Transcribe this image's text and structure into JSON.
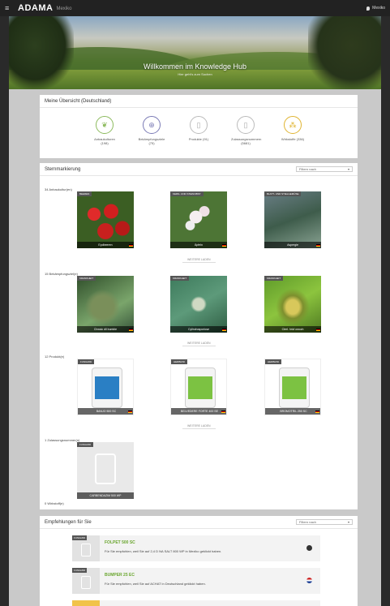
{
  "topbar": {
    "menu_icon": "≡",
    "logo": "ADAMA",
    "logo_sub": "Mexiko",
    "user_label": "Mexiko"
  },
  "hero": {
    "title": "Willkommen im Knowledge Hub",
    "subtitle": "Hier geht's zum Suchen"
  },
  "overview": {
    "title": "Meine Übersicht (Deutschland)",
    "items": [
      {
        "label": "Anbaukulturen (198)",
        "icon": "sprout-icon",
        "glyph": "❦",
        "color": "#8dbb5e"
      },
      {
        "label": "Bekämpfungsziele (75)",
        "icon": "target-icon",
        "glyph": "⊕",
        "color": "#7a7ab5"
      },
      {
        "label": "Produkte (91)",
        "icon": "canister-icon",
        "glyph": "▯",
        "color": "#aaaaaa"
      },
      {
        "label": "Zulassungsnummern (5681)",
        "icon": "document-icon",
        "glyph": "▯",
        "color": "#aaaaaa"
      },
      {
        "label": "Wirkstoffe (336)",
        "icon": "molecule-icon",
        "glyph": "⁂",
        "color": "#e0b430"
      }
    ]
  },
  "stars": {
    "title": "Sternmarkierung",
    "filter": "Filtern nach",
    "crops_label": "34 Anbaukultur(en)",
    "crops": [
      {
        "tag": "BEEREN",
        "name": "Ерdbeeren"
      },
      {
        "tag": "KERN- UND STEINOBST",
        "name": "Äpfeln"
      },
      {
        "tag": "BLATT- UND STIELGEMÜSE",
        "name": "Aspergie"
      }
    ],
    "more1": "WEITERE LADEN",
    "targets_label": "15 Bekämpfungsziel(e)",
    "targets": [
      {
        "tag": "KRANKHEIT",
        "name": "Chwsiс dll bumble"
      },
      {
        "tag": "KRANKHEIT",
        "name": "Cylindrosporiose"
      },
      {
        "tag": "KRANKHEIT",
        "name": "Cterl. hrivl owoch"
      }
    ],
    "more2": "WEITERE LADEN",
    "products_label": "12 Produkt(e)",
    "products": [
      {
        "tag": "FUNGIZID",
        "name": "BANJO 500 SC",
        "label_color": "#2a7fc4"
      },
      {
        "tag": "HERBIZID",
        "name": "BELVEDERE FORTE 400 SE",
        "label_color": "#7cc242"
      },
      {
        "tag": "HERBIZID",
        "name": "BROMOTRIL 250 SC",
        "label_color": "#7cc242"
      }
    ],
    "more3": "WEITERE LADEN",
    "regs_label": "1 Zulassungsnummer(n)",
    "regs": [
      {
        "tag": "FUNGIZID",
        "name": "CARBENDAZIM 500 WP"
      }
    ],
    "actives_label": "0 Wirkstoff(e)"
  },
  "recs": {
    "title": "Empfehlungen für Sie",
    "filter": "Filtern nach",
    "items": [
      {
        "tag": "FUNGIZID",
        "name": "FOLPET 500 SC",
        "desc": "Für Sie empfohlen, weil Sie auf 2,4 D NA SALT 800 WP in Mexiko geklickt haben."
      },
      {
        "tag": "FUNGIZID",
        "name": "BUMPER 25 EC",
        "desc": "Für Sie empfohlen, weil Sie auf ACHAT in Deutschland geklickt haben."
      }
    ]
  }
}
